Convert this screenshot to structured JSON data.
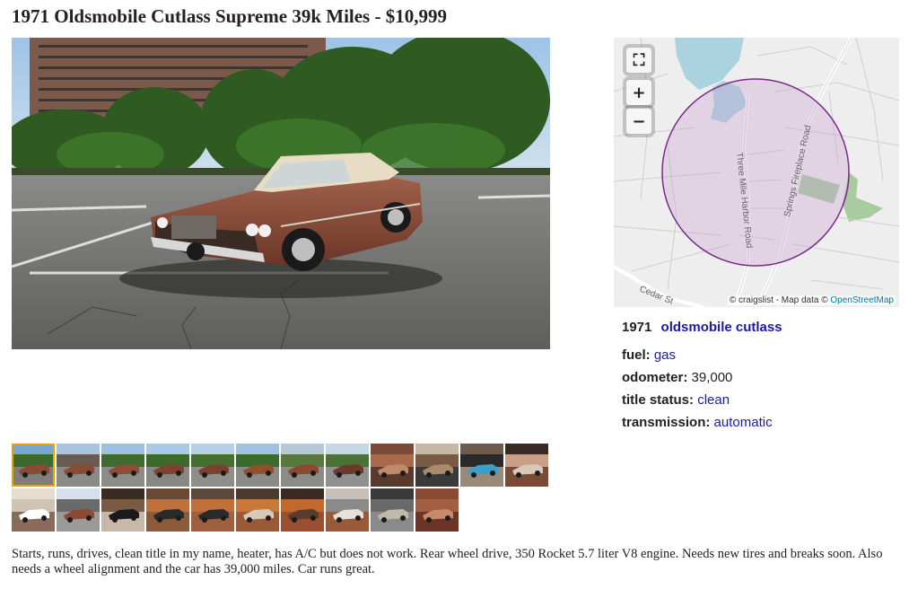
{
  "listing": {
    "title": "1971 Oldsmobile Cutlass Supreme 39k Miles - $10,999",
    "description": "Starts, runs, drives, clean title in my name, heater, has A/C but does not work. Rear wheel drive, 350 Rocket 5.7 liter V8 engine. Needs new tires and breaks soon. Also needs a wheel alignment and the car has 39,000 miles. Car runs great."
  },
  "map": {
    "attribution_prefix": "© craigslist - Map data ©",
    "attribution_link": "OpenStreetMap",
    "road_labels": [
      "Three Mile Harbor Road",
      "Springs Fireplace Road",
      "Cedar St"
    ],
    "controls": [
      "fullscreen-icon",
      "zoom-in-icon",
      "zoom-out-icon"
    ],
    "fullscreen_glyph": "⛶",
    "zoom_in_glyph": "+",
    "zoom_out_glyph": "−",
    "circle_color": "#7a2a8a"
  },
  "attributes": {
    "year": "1971",
    "model": "oldsmobile cutlass",
    "fuel_label": "fuel:",
    "fuel_value": "gas",
    "odometer_label": "odometer:",
    "odometer_value": "39,000",
    "title_status_label": "title status:",
    "title_status_value": "clean",
    "transmission_label": "transmission:",
    "transmission_value": "automatic"
  },
  "thumbnails": {
    "row1": [
      "car-front-left",
      "car-side-building",
      "car-side-left",
      "car-rear-left",
      "car-rear",
      "car-side-right",
      "car-side-trees",
      "car-front",
      "trunk-open",
      "steering-wheel",
      "console",
      "door-panel"
    ],
    "row2": [
      "roof-closeup",
      "car-street",
      "dashboard",
      "seat",
      "interior-front",
      "interior-rear",
      "rear-seats",
      "car-side-brown",
      "engine-bay",
      "fender-closeup"
    ],
    "active_index": 0
  },
  "colors": {
    "link": "#1a1aa6",
    "active_thumb_border": "#e9a200"
  }
}
